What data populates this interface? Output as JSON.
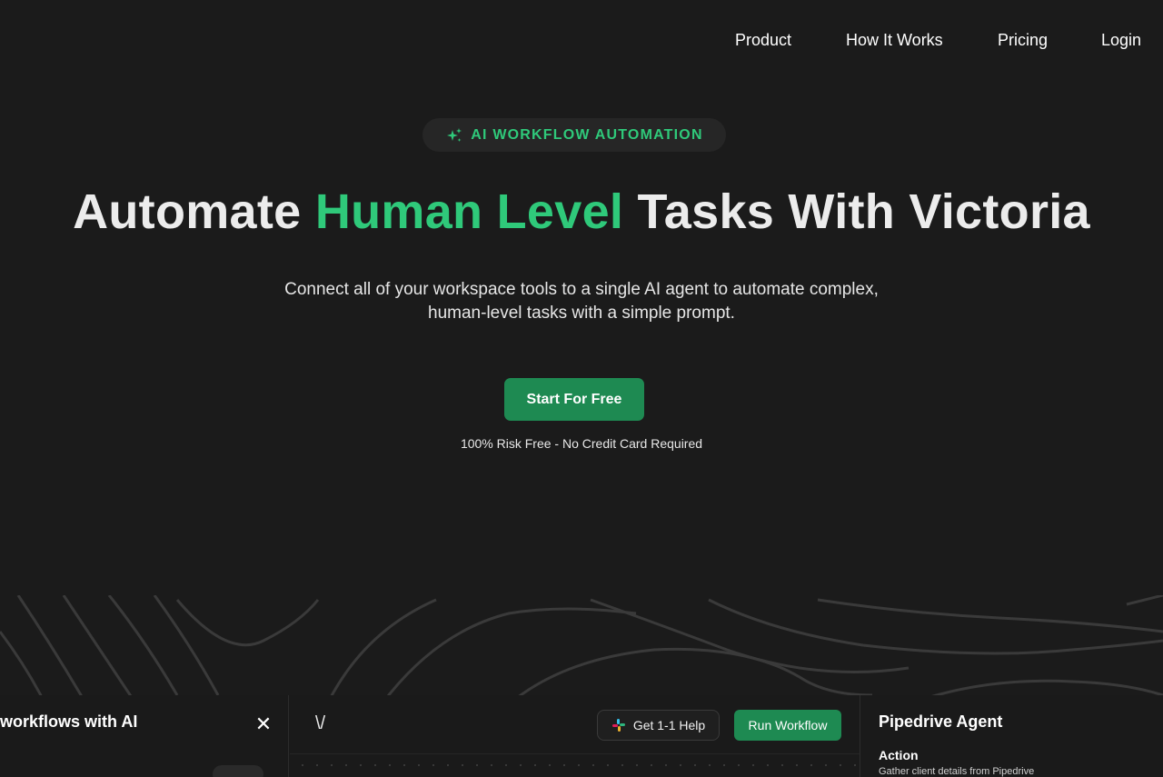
{
  "nav": {
    "items": [
      {
        "label": "Product"
      },
      {
        "label": "How It Works"
      },
      {
        "label": "Pricing"
      },
      {
        "label": "Login"
      }
    ]
  },
  "hero": {
    "badge": "AI WORKFLOW AUTOMATION",
    "headline_pre": "Automate ",
    "headline_accent": "Human Level",
    "headline_post": " Tasks With Victoria",
    "subtext_line1": "Connect all of your workspace tools to a single AI agent to automate complex,",
    "subtext_line2": "human-level tasks with a simple prompt.",
    "cta_label": "Start For Free",
    "cta_note": "100% Risk Free - No Credit Card Required"
  },
  "preview": {
    "left_title": "workflows with AI",
    "close_glyph": "✕",
    "chevron_glyph": "\\/",
    "help_label": "Get 1-1 Help",
    "run_label": "Run Workflow",
    "agent_title": "Pipedrive Agent",
    "action_label": "Action",
    "action_desc": "Gather client details from Pipedrive"
  },
  "colors": {
    "background": "#1b1b1b",
    "accent": "#2fc97a",
    "button": "#1e8a52"
  },
  "icons": [
    "sparkle-icon",
    "close-icon",
    "chevron-icon",
    "slack-icon"
  ]
}
